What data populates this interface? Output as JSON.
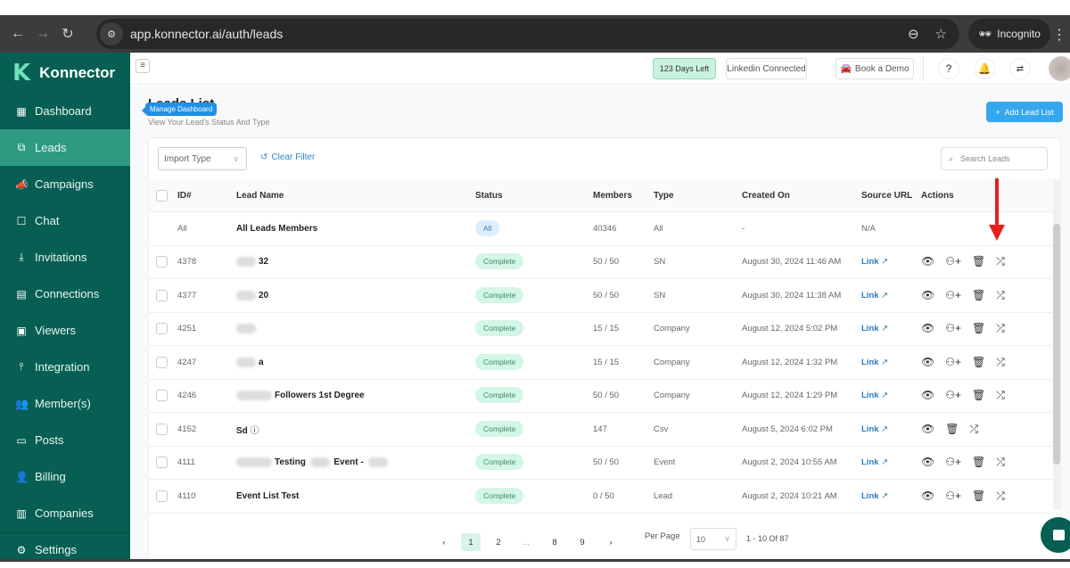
{
  "browser": {
    "url": "app.konnector.ai/auth/leads",
    "incognito_label": "Incognito"
  },
  "sidebar": {
    "brand": "Konnector",
    "items": [
      {
        "label": "Dashboard",
        "icon": "dashboard-icon"
      },
      {
        "label": "Leads",
        "icon": "leads-icon",
        "active": true
      },
      {
        "label": "Campaigns",
        "icon": "megaphone-icon"
      },
      {
        "label": "Chat",
        "icon": "chat-icon"
      },
      {
        "label": "Invitations",
        "icon": "invitations-icon"
      },
      {
        "label": "Connections",
        "icon": "connections-icon"
      },
      {
        "label": "Viewers",
        "icon": "viewers-icon"
      },
      {
        "label": "Integration",
        "icon": "integration-icon"
      },
      {
        "label": "Member(s)",
        "icon": "members-icon"
      },
      {
        "label": "Posts",
        "icon": "posts-icon"
      },
      {
        "label": "Billing",
        "icon": "billing-icon"
      },
      {
        "label": "Companies",
        "icon": "companies-icon"
      },
      {
        "label": "Settings",
        "icon": "gear-icon"
      }
    ]
  },
  "header": {
    "days_left": "123 Days Left",
    "linkedin_status": "Linkedin Connected",
    "book_demo": "Book a Demo"
  },
  "page": {
    "title": "Leads List",
    "subtitle": "View Your Lead's Status And Type",
    "tooltip": "Manage Dashboard",
    "add_button": "Add Lead List"
  },
  "filters": {
    "import_type_placeholder": "Import Type",
    "clear_filter": "Clear Filter",
    "search_placeholder": "Search Leads"
  },
  "table": {
    "columns": [
      "ID#",
      "Lead Name",
      "Status",
      "Members",
      "Type",
      "Created On",
      "Source URL",
      "Actions"
    ],
    "all_row": {
      "id": "All",
      "name": "All Leads Members",
      "status": "All",
      "members": "40346",
      "type": "All",
      "created": "-",
      "source": "N/A"
    },
    "rows": [
      {
        "id": "4378",
        "name": "32",
        "name_redacted": true,
        "status": "Complete",
        "members": "50 / 50",
        "type": "SN",
        "created": "August 30, 2024 11:46 AM",
        "source": "Link",
        "actions": [
          "view",
          "add-member",
          "delete",
          "shuffle"
        ]
      },
      {
        "id": "4377",
        "name": "20",
        "name_redacted": true,
        "status": "Complete",
        "members": "50 / 50",
        "type": "SN",
        "created": "August 30, 2024 11:38 AM",
        "source": "Link",
        "actions": [
          "view",
          "add-member",
          "delete",
          "shuffle"
        ]
      },
      {
        "id": "4251",
        "name": "",
        "name_redacted": true,
        "status": "Complete",
        "members": "15 / 15",
        "type": "Company",
        "created": "August 12, 2024 5:02 PM",
        "source": "Link",
        "actions": [
          "view",
          "add-member",
          "delete",
          "shuffle"
        ]
      },
      {
        "id": "4247",
        "name": "a",
        "name_redacted": true,
        "status": "Complete",
        "members": "15 / 15",
        "type": "Company",
        "created": "August 12, 2024 1:32 PM",
        "source": "Link",
        "actions": [
          "view",
          "add-member",
          "delete",
          "shuffle"
        ]
      },
      {
        "id": "4246",
        "name": "Followers 1st Degree",
        "name_redacted": true,
        "status": "Complete",
        "members": "50 / 50",
        "type": "Company",
        "created": "August 12, 2024 1:29 PM",
        "source": "Link",
        "actions": [
          "view",
          "add-member",
          "delete",
          "shuffle"
        ]
      },
      {
        "id": "4152",
        "name": "Sd",
        "name_info_icon": true,
        "status": "Complete",
        "members": "147",
        "type": "Csv",
        "created": "August 5, 2024 6:02 PM",
        "source": "Link",
        "actions": [
          "view",
          "delete",
          "shuffle"
        ]
      },
      {
        "id": "4111",
        "name": "Testing ▒ Event - ▒",
        "name_redacted": true,
        "status": "Complete",
        "members": "50 / 50",
        "type": "Event",
        "created": "August 2, 2024 10:55 AM",
        "source": "Link",
        "actions": [
          "view",
          "add-member",
          "delete",
          "shuffle"
        ]
      },
      {
        "id": "4110",
        "name": "Event List Test",
        "status": "Complete",
        "members": "0 / 50",
        "type": "Lead",
        "created": "August 2, 2024 10:21 AM",
        "source": "Link",
        "actions": [
          "view",
          "add-member",
          "delete",
          "shuffle"
        ]
      }
    ]
  },
  "pagination": {
    "pages": [
      "1",
      "2",
      "...",
      "8",
      "9"
    ],
    "current": "1",
    "per_page_label": "Per Page",
    "per_page_value": "10",
    "range": "1 - 10 Of 87"
  },
  "colors": {
    "sidebar_bg": "#065f52",
    "sidebar_active": "#2e9a82",
    "accent_blue": "#35a7ee",
    "complete_badge": "#d3f6e6",
    "annotation_arrow": "#e5201b"
  }
}
